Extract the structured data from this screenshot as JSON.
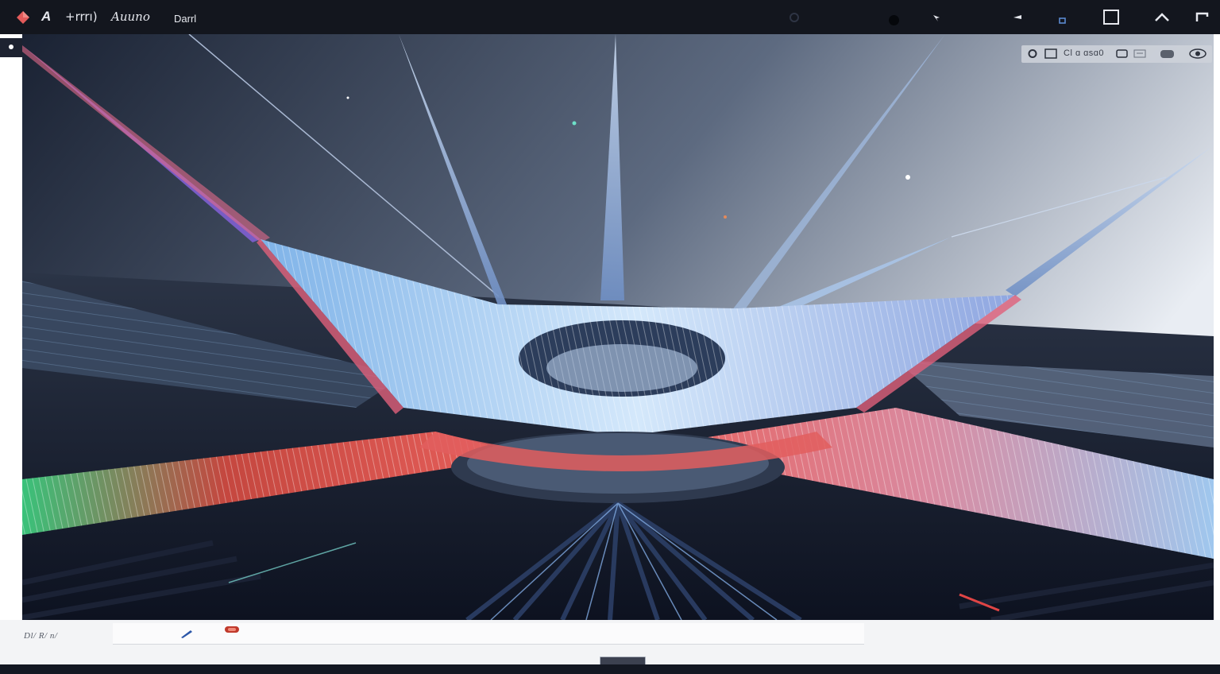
{
  "titlebar": {
    "letter": "A",
    "text_1": "+rrrı)",
    "text_2": "Auuno",
    "text_3": "Darrl"
  },
  "icons": {
    "app_logo": "diamond-logo-icon",
    "pin": "pin-icon",
    "minimize": "minimize-icon",
    "restore": "restore-icon",
    "maximize": "maximize-icon",
    "collapse": "chevron-up-icon",
    "close": "close-icon",
    "ov_circle": "circle-icon",
    "ov_camera": "camera-icon",
    "ov_eye": "eye-icon",
    "pen": "pen-icon",
    "chip": "tag-icon"
  },
  "overlay": {
    "label": "Cl ɑ ɑsɑ0"
  },
  "bottombar": {
    "label": "Dl/ R/ n/"
  },
  "colors": {
    "titlebar_bg": "#13161e",
    "accent_red": "#e35b5b",
    "sky_dark": "#1a2233",
    "sky_light": "#e9edf3",
    "structure_blue": "#9cc7ec"
  }
}
